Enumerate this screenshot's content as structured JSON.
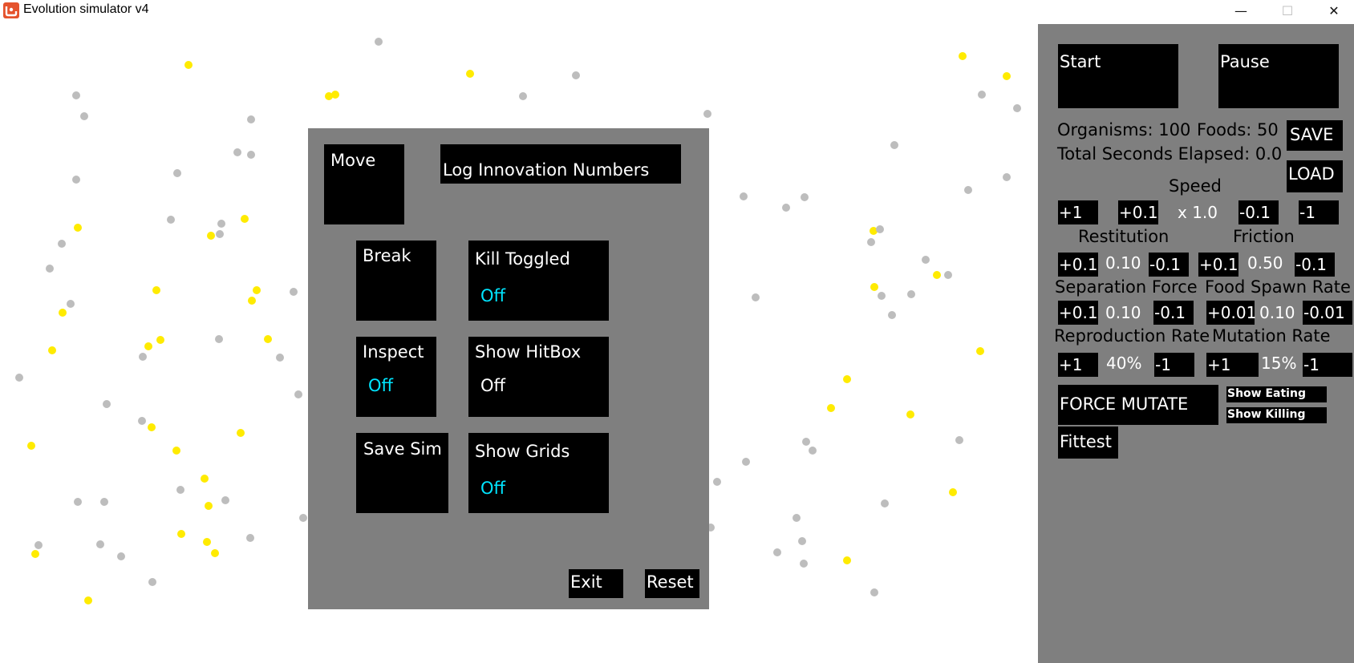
{
  "window": {
    "title": "Evolution simulator v4",
    "minimize_icon": "minimize-icon",
    "maximize_icon": "maximize-icon",
    "close_icon": "close-icon"
  },
  "colors": {
    "food": "#ffeb00",
    "organism": "#bdbdbd",
    "panel": "#7f7f7f",
    "toggle_on": "#00e5ff"
  },
  "overlay": {
    "move": "Move",
    "log_innovation": "Log Innovation Numbers",
    "break": "Break",
    "kill_toggled": "Kill Toggled",
    "kill_toggled_state": "Off",
    "inspect": "Inspect",
    "inspect_state": "Off",
    "show_hitbox": "Show HitBox",
    "show_hitbox_state": "Off",
    "save_sim": "Save Sim",
    "show_grids": "Show Grids",
    "show_grids_state": "Off",
    "exit": "Exit",
    "reset": "Reset"
  },
  "sidebar": {
    "start": "Start",
    "pause": "Pause",
    "organisms": "Organisms: 100",
    "foods": "Foods: 50",
    "save": "SAVE",
    "elapsed": "Total Seconds Elapsed: 0.0",
    "load": "LOAD",
    "speed": {
      "label": "Speed",
      "plus1": "+1",
      "plus01": "+0.1",
      "value": "x 1.0",
      "minus01": "-0.1",
      "minus1": "-1"
    },
    "restitution": {
      "label": "Restitution",
      "plus": "+0.1",
      "value": "0.10",
      "minus": "-0.1"
    },
    "friction": {
      "label": "Friction",
      "plus": "+0.1",
      "value": "0.50",
      "minus": "-0.1"
    },
    "separation": {
      "label": "Separation Force",
      "plus": "+0.1",
      "value": "0.10",
      "minus": "-0.1"
    },
    "food_spawn": {
      "label": "Food Spawn Rate",
      "plus": "+0.01",
      "value": "0.10",
      "minus": "-0.01"
    },
    "reproduction": {
      "label": "Reproduction Rate",
      "plus": "+1",
      "value": "40%",
      "minus": "-1"
    },
    "mutation": {
      "label": "Mutation Rate",
      "plus": "+1",
      "value": "15%",
      "minus": "-1"
    },
    "force_mutate": "FORCE MUTATE",
    "show_eating": "Show Eating",
    "show_killing": "Show Killing",
    "fittest": "Fittest"
  }
}
